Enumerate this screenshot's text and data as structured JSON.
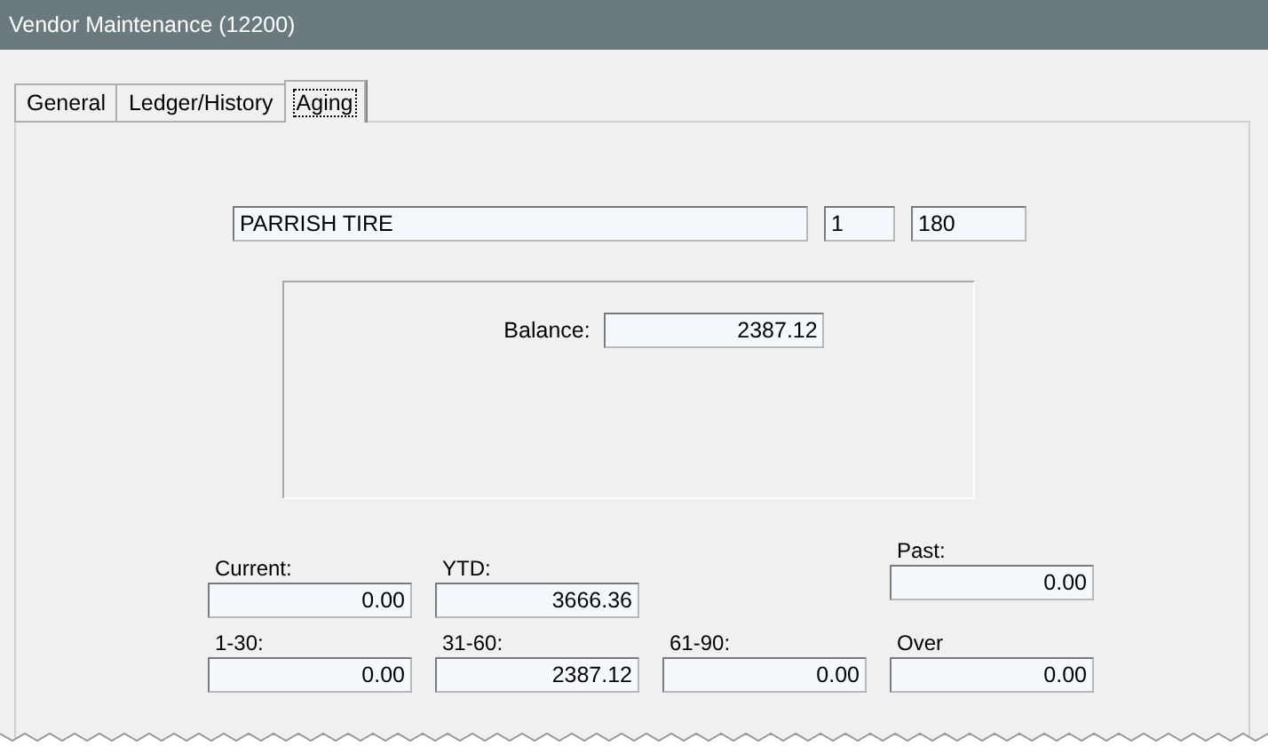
{
  "window": {
    "title": "Vendor Maintenance (12200)"
  },
  "tabs": [
    {
      "label": "General",
      "selected": false
    },
    {
      "label": "Ledger/History",
      "selected": false
    },
    {
      "label": "Aging",
      "selected": true
    }
  ],
  "vendor": {
    "name": "PARRISH TIRE",
    "field_2": "1",
    "field_3": "180"
  },
  "balance": {
    "label": "Balance:",
    "value": "2387.12"
  },
  "aging_top": [
    {
      "label": "Current:",
      "value": "0.00"
    },
    {
      "label": "YTD:",
      "value": "3666.36"
    },
    {
      "label": "Past:",
      "value": "0.00"
    }
  ],
  "aging": [
    {
      "label": "1-30:",
      "value": "0.00"
    },
    {
      "label": "31-60:",
      "value": "2387.12"
    },
    {
      "label": "61-90:",
      "value": "0.00"
    },
    {
      "label": "Over",
      "value": "0.00"
    }
  ]
}
